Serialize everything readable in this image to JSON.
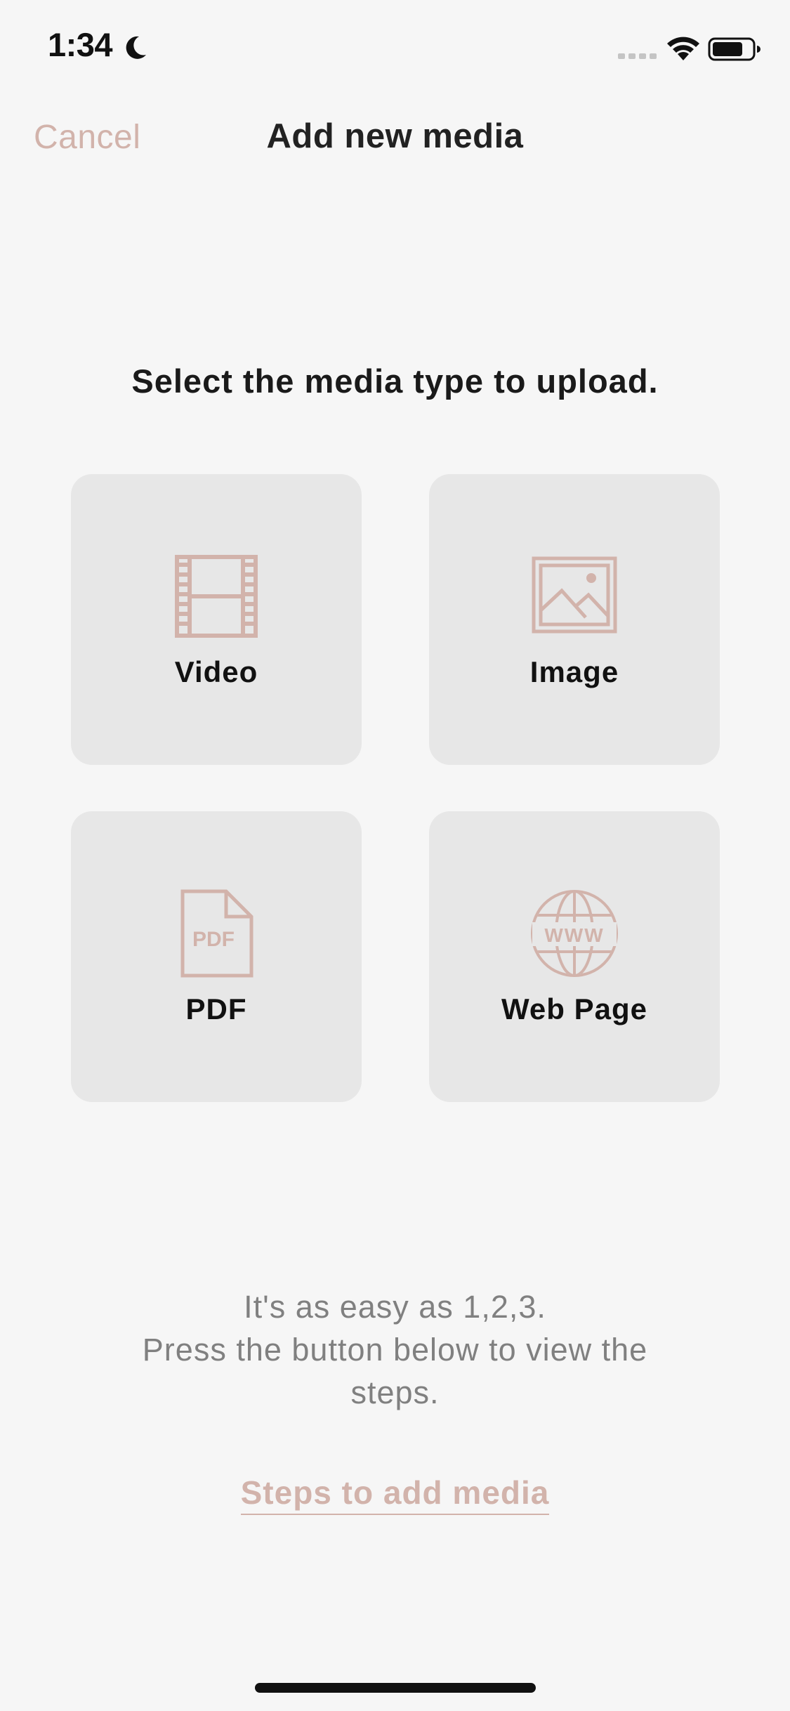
{
  "status_bar": {
    "time": "1:34",
    "icons": [
      "moon-icon",
      "signal-icon",
      "wifi-icon",
      "battery-icon"
    ]
  },
  "nav": {
    "cancel_label": "Cancel",
    "title": "Add new media"
  },
  "prompt": "Select the media type to upload.",
  "tiles": [
    {
      "label": "Video",
      "icon": "film-icon"
    },
    {
      "label": "Image",
      "icon": "image-icon"
    },
    {
      "label": "PDF",
      "icon": "pdf-file-icon"
    },
    {
      "label": "Web Page",
      "icon": "globe-www-icon"
    }
  ],
  "info": {
    "line1": "It's as easy as 1,2,3.",
    "line2": "Press the button below to view the",
    "line3": "steps."
  },
  "steps_link_label": "Steps to add media",
  "colors": {
    "accent": "#d2b3ab",
    "background": "#f6f6f6",
    "tile_background": "#e7e7e7",
    "muted_text": "#808080"
  }
}
